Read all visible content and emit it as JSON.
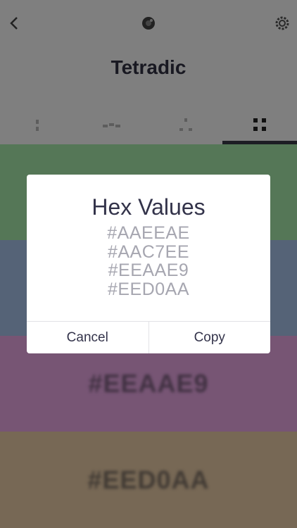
{
  "header": {
    "title": "Tetradic"
  },
  "icons": {
    "back": "chevron-left-icon",
    "palette": "palette-icon",
    "settings": "gear-icon"
  },
  "tabs": [
    {
      "name": "tab-single",
      "icon": "single-swatch-icon"
    },
    {
      "name": "tab-analogous",
      "icon": "analogous-icon"
    },
    {
      "name": "tab-triadic",
      "icon": "triadic-icon"
    },
    {
      "name": "tab-tetradic",
      "icon": "tetradic-icon",
      "active": true
    }
  ],
  "bands": [
    {
      "hex": "#AAEEAE",
      "color": "#aaeeae",
      "label": ""
    },
    {
      "hex": "#AAC7EE",
      "color": "#aac7ee",
      "label": ""
    },
    {
      "hex": "#EEAAE9",
      "color": "#eeaae9",
      "label": "#EEAAE9"
    },
    {
      "hex": "#EED0AA",
      "color": "#eed0aa",
      "label": "#EED0AA"
    }
  ],
  "dialog": {
    "title": "Hex Values",
    "values": [
      "#AAEEAE",
      "#AAC7EE",
      "#EEAAE9",
      "#EED0AA"
    ],
    "cancel_label": "Cancel",
    "copy_label": "Copy"
  }
}
